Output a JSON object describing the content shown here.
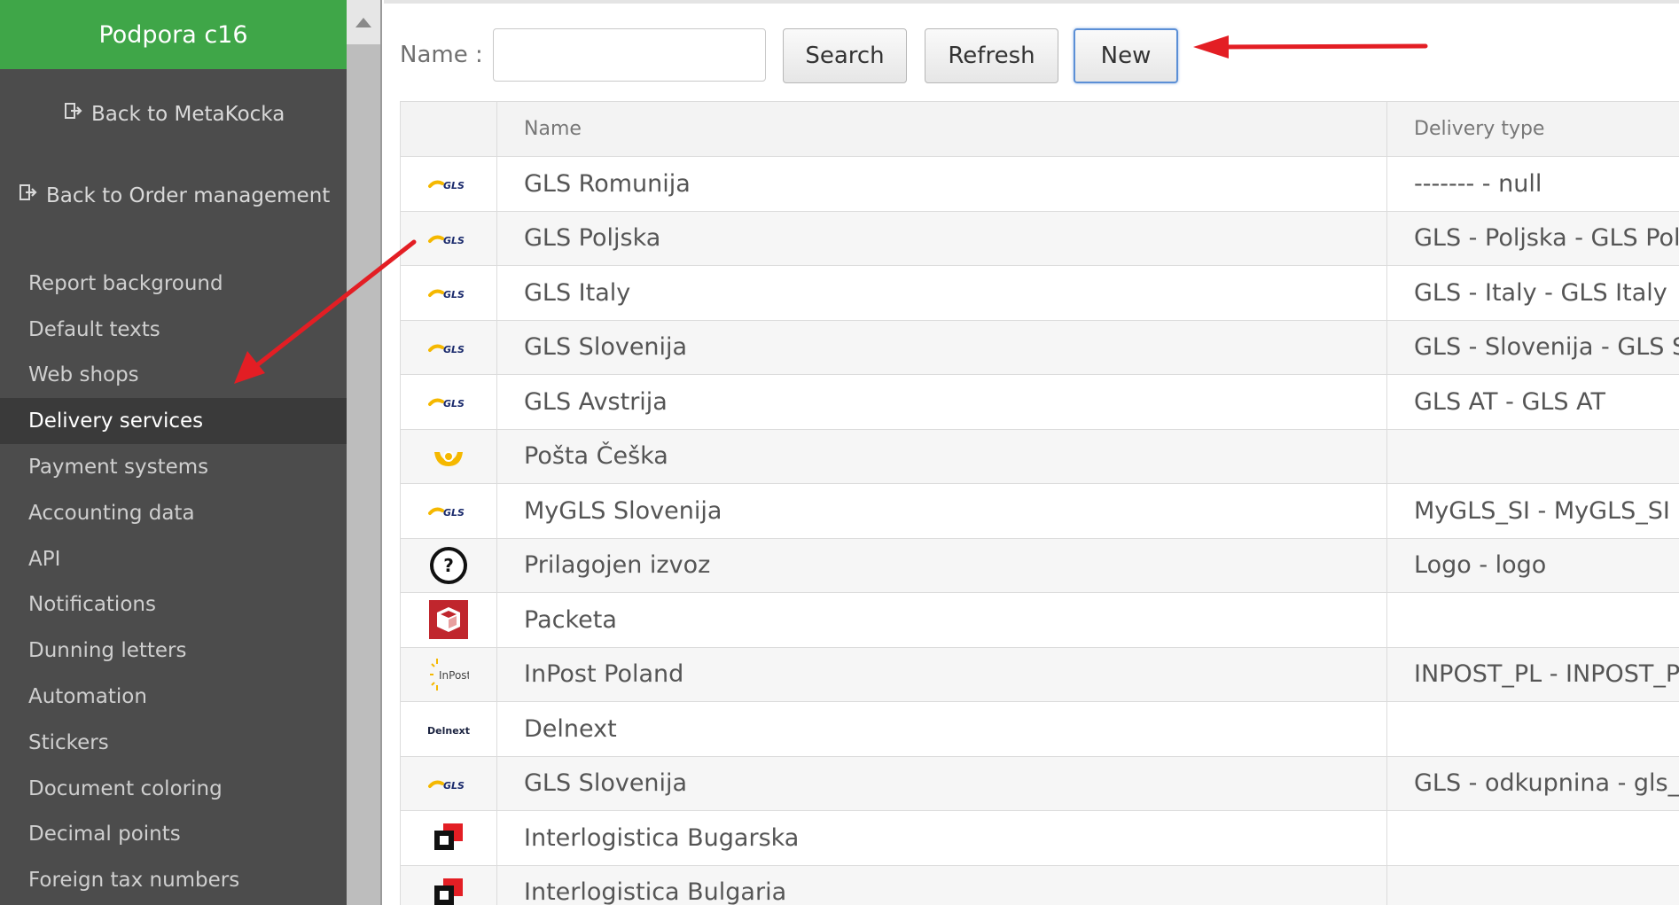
{
  "sidebar": {
    "title": "Podpora c16",
    "back_links": [
      {
        "icon": "sign-out-icon",
        "label": "Back to MetaKocka"
      },
      {
        "icon": "sign-out-icon",
        "label": "Back to Order management"
      }
    ],
    "menu": [
      {
        "label": "Report background"
      },
      {
        "label": "Default texts"
      },
      {
        "label": "Web shops"
      },
      {
        "label": "Delivery services",
        "active": true
      },
      {
        "label": "Payment systems"
      },
      {
        "label": "Accounting data"
      },
      {
        "label": "API"
      },
      {
        "label": "Notifications"
      },
      {
        "label": "Dunning letters"
      },
      {
        "label": "Automation"
      },
      {
        "label": "Stickers"
      },
      {
        "label": "Document coloring"
      },
      {
        "label": "Decimal points"
      },
      {
        "label": "Foreign tax numbers"
      }
    ]
  },
  "toolbar": {
    "name_label": "Name :",
    "name_value": "",
    "search_label": "Search",
    "refresh_label": "Refresh",
    "new_label": "New"
  },
  "table": {
    "columns": [
      "",
      "Name",
      "Delivery type"
    ],
    "rows": [
      {
        "logo": "gls-logo",
        "name": "GLS Romunija",
        "type": "------- - null"
      },
      {
        "logo": "gls-logo",
        "name": "GLS Poljska",
        "type": "GLS - Poljska - GLS Poland"
      },
      {
        "logo": "gls-logo",
        "name": "GLS Italy",
        "type": "GLS - Italy - GLS Italy"
      },
      {
        "logo": "gls-logo",
        "name": "GLS Slovenija",
        "type": "GLS - Slovenija - GLS Slovenija"
      },
      {
        "logo": "gls-logo",
        "name": "GLS Avstrija",
        "type": "GLS AT - GLS AT"
      },
      {
        "logo": "posta-horn-logo",
        "name": "Pošta Češka",
        "type": ""
      },
      {
        "logo": "gls-logo",
        "name": "MyGLS Slovenija",
        "type": "MyGLS_SI - MyGLS_SI"
      },
      {
        "logo": "question-mark-icon",
        "name": "Prilagojen izvoz",
        "type": "Logo - logo"
      },
      {
        "logo": "packeta-logo",
        "name": "Packeta",
        "type": ""
      },
      {
        "logo": "inpost-logo",
        "name": "InPost Poland",
        "type": "INPOST_PL - INPOST_PL"
      },
      {
        "logo": "delnext-logo",
        "name": "Delnext",
        "type": ""
      },
      {
        "logo": "gls-logo",
        "name": "GLS Slovenija",
        "type": "GLS - odkupnina - gls_with"
      },
      {
        "logo": "interlogistica-logo",
        "name": "Interlogistica Bugarska",
        "type": ""
      },
      {
        "logo": "interlogistica-logo",
        "name": "Interlogistica Bulgaria",
        "type": ""
      }
    ]
  },
  "logo_texts": {
    "gls": "GLS",
    "inpost": "InPost",
    "delnext": "Delnext",
    "question": "?"
  },
  "colors": {
    "sidebar_header": "#3fa648",
    "sidebar_bg": "#4c4c4c",
    "sidebar_active": "#3a3a3a",
    "gls_yellow": "#f5b800",
    "gls_blue": "#1a2a6c",
    "arrow_red": "#e31e24",
    "packeta_red": "#c0262d"
  }
}
